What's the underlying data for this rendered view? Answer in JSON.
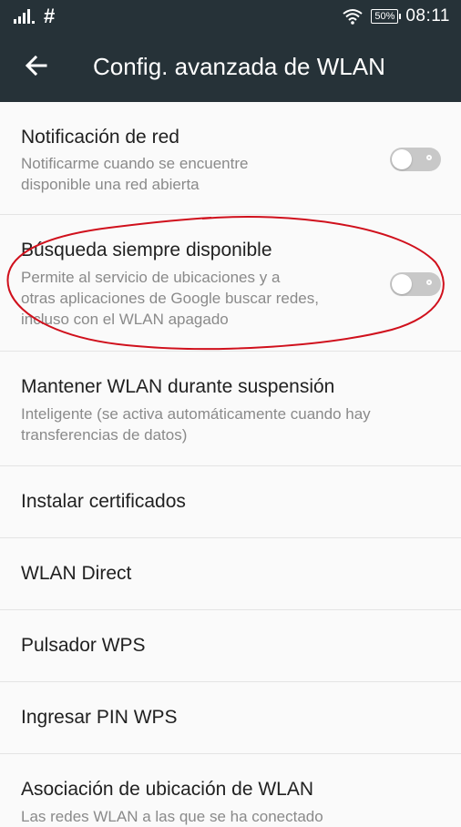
{
  "status_bar": {
    "signal_icon": "signal-bars-icon",
    "extra_indicator": "#",
    "wifi_icon": "wifi-icon",
    "battery_percent": "50%",
    "time": "08:11"
  },
  "app_bar": {
    "back_icon": "arrow-left-icon",
    "title": "Config. avanzada de WLAN"
  },
  "settings": [
    {
      "title": "Notificación de red",
      "subtitle": "Notificarme cuando se encuentre\ndisponible una red abierta",
      "toggle_on": false
    },
    {
      "title": "Búsqueda siempre disponible",
      "subtitle": "Permite al servicio de ubicaciones y a\notras aplicaciones de Google buscar redes,\nincluso con el WLAN apagado",
      "toggle_on": false
    },
    {
      "title": "Mantener WLAN durante suspensión",
      "subtitle": "Inteligente (se activa automáticamente cuando hay\ntransferencias de datos)"
    },
    {
      "title": "Instalar certificados"
    },
    {
      "title": "WLAN Direct"
    },
    {
      "title": "Pulsador WPS"
    },
    {
      "title": "Ingresar PIN WPS"
    },
    {
      "title": "Asociación de ubicación de WLAN",
      "subtitle": "Las redes WLAN a las que se ha conectado"
    }
  ],
  "colors": {
    "app_bar": "#263238",
    "annotation": "#d0101c",
    "toggle_off": "#c8c8c8"
  }
}
